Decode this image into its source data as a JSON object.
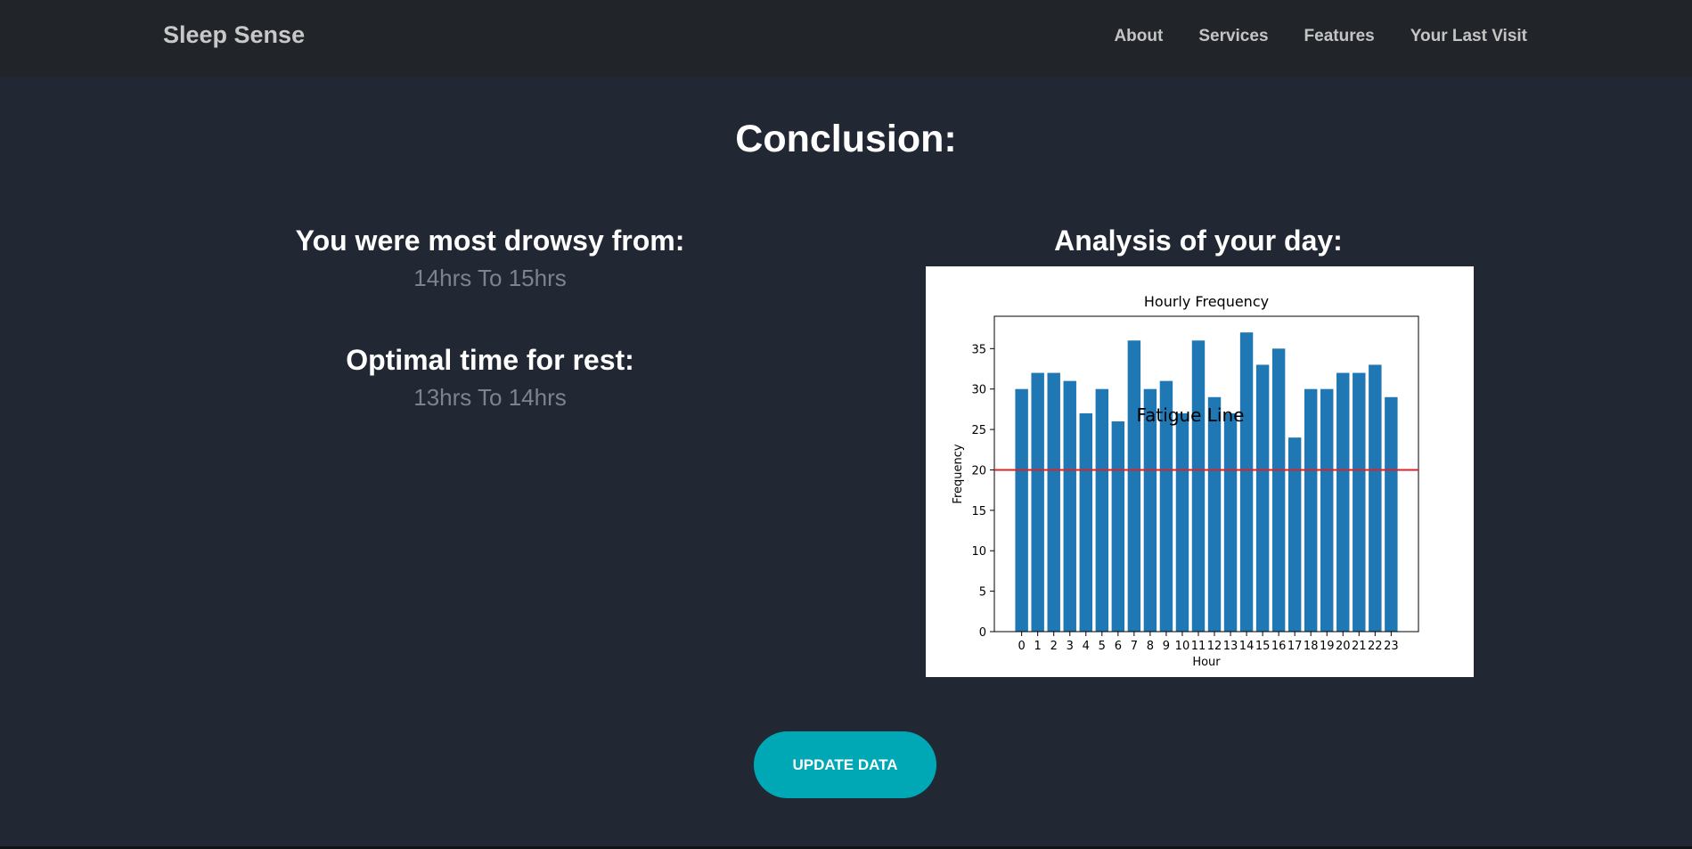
{
  "navbar": {
    "brand": "Sleep Sense",
    "links": [
      "About",
      "Services",
      "Features",
      "Your Last Visit"
    ]
  },
  "main": {
    "title": "Conclusion:",
    "drowsy_heading": "You were most drowsy from:",
    "drowsy_value": "14hrs To 15hrs",
    "rest_heading": "Optimal time for rest:",
    "rest_value": "13hrs To 14hrs",
    "analysis_heading": "Analysis of your day:",
    "update_button": "UPDATE DATA"
  },
  "colors": {
    "bar": "#1f77b4",
    "fatigue_line": "#d62728",
    "button": "#00a8b5"
  },
  "chart_data": {
    "type": "bar",
    "title": "Hourly Frequency",
    "xlabel": "Hour",
    "ylabel": "Frequency",
    "categories": [
      "0",
      "1",
      "2",
      "3",
      "4",
      "5",
      "6",
      "7",
      "8",
      "9",
      "10",
      "11",
      "12",
      "13",
      "14",
      "15",
      "16",
      "17",
      "18",
      "19",
      "20",
      "21",
      "22",
      "23"
    ],
    "values": [
      30,
      32,
      32,
      31,
      27,
      30,
      26,
      36,
      30,
      31,
      27,
      36,
      29,
      27,
      37,
      33,
      35,
      24,
      30,
      30,
      32,
      32,
      33,
      29
    ],
    "ylim": [
      0,
      39
    ],
    "yticks": [
      0,
      5,
      10,
      15,
      20,
      25,
      30,
      35
    ],
    "reference_line": {
      "value": 20,
      "label": "Fatigue Line",
      "label_x": 10.5,
      "label_y": 26
    }
  }
}
